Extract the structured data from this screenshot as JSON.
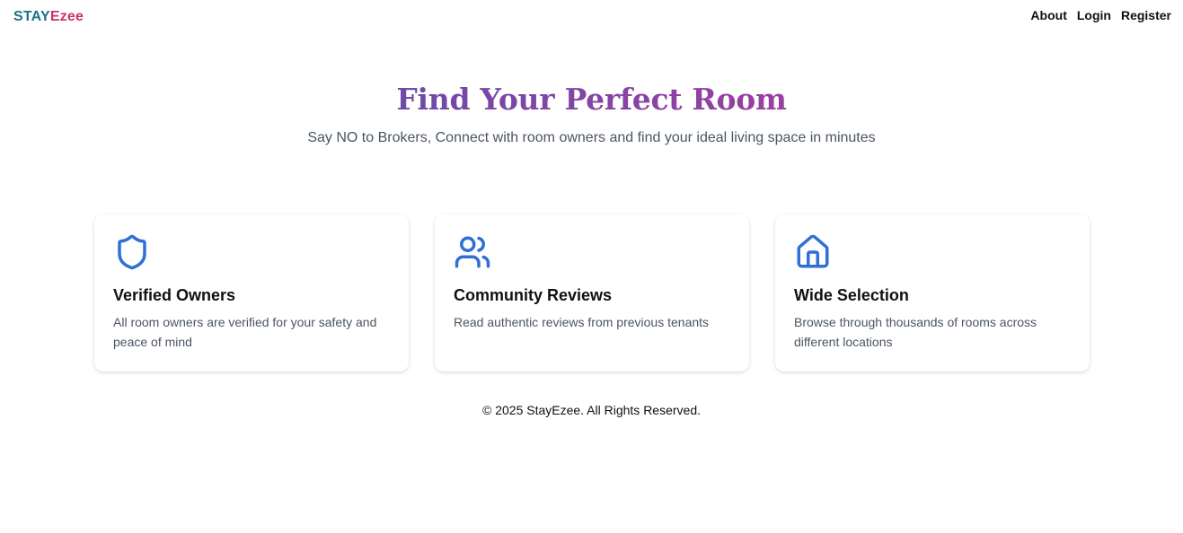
{
  "header": {
    "brand_part1": "STAY",
    "brand_part2": "Ezee",
    "nav": [
      {
        "label": "About"
      },
      {
        "label": "Login"
      },
      {
        "label": "Register"
      }
    ]
  },
  "hero": {
    "title": "Find Your Perfect Room",
    "subtitle": "Say NO to Brokers, Connect with room owners and find your ideal living space in minutes"
  },
  "features": [
    {
      "icon": "shield-icon",
      "title": "Verified Owners",
      "description": "All room owners are verified for your safety and peace of mind"
    },
    {
      "icon": "users-icon",
      "title": "Community Reviews",
      "description": "Read authentic reviews from previous tenants"
    },
    {
      "icon": "home-icon",
      "title": "Wide Selection",
      "description": "Browse through thousands of rooms across different locations"
    }
  ],
  "footer": {
    "text": "© 2025 StayEzee. All Rights Reserved."
  },
  "colors": {
    "brand_primary": "#1f6f8b",
    "brand_accent": "#c8326e",
    "title_gradient_start": "#6e4aa8",
    "title_gradient_end": "#9a3fa0",
    "icon_blue": "#2f6fd6",
    "muted_text": "#4b5563"
  }
}
